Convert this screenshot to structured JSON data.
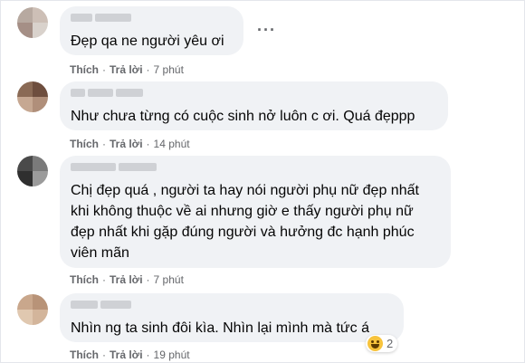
{
  "colors": {
    "bubble": "#f0f2f5",
    "meta_text": "#65676b",
    "body_text": "#050505"
  },
  "icons": {
    "more": "more-options-icon",
    "reaction": "haha-reaction-icon"
  },
  "comments": [
    {
      "text": "Đẹp qa ne người yêu ơi",
      "like": "Thích",
      "reply": "Trả lời",
      "sep": "·",
      "time": "7 phút"
    },
    {
      "text": "Như chưa từng có cuộc sinh nở luôn c ơi. Quá đẹppp",
      "like": "Thích",
      "reply": "Trả lời",
      "sep": "·",
      "time": "14 phút"
    },
    {
      "text": "Chị đẹp quá , người ta hay nói người phụ nữ đẹp nhất\nkhi không thuộc về ai nhưng giờ e thấy người phụ nữ\nđẹp nhất khi gặp đúng người và hưởng đc hạnh phúc\nviên mãn",
      "like": "Thích",
      "reply": "Trả lời",
      "sep": "·",
      "time": "7 phút"
    },
    {
      "text": "Nhìn ng ta sinh đôi kìa. Nhìn lại mình mà tức á",
      "like": "Thích",
      "reply": "Trả lời",
      "sep": "·",
      "time": "19 phút",
      "reaction_count": "2"
    }
  ],
  "more_symbol": "···"
}
